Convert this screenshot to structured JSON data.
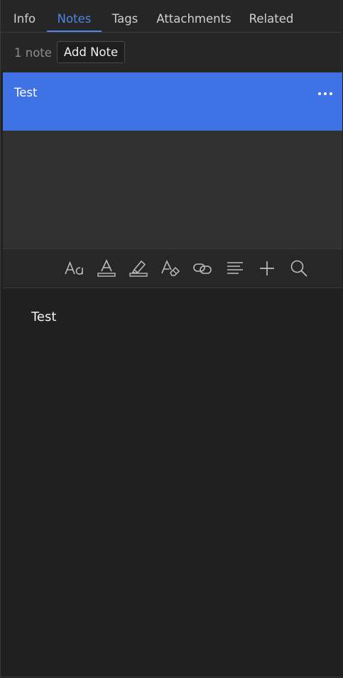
{
  "tabs": [
    {
      "label": "Info",
      "active": false
    },
    {
      "label": "Notes",
      "active": true
    },
    {
      "label": "Tags",
      "active": false
    },
    {
      "label": "Attachments",
      "active": false
    },
    {
      "label": "Related",
      "active": false
    }
  ],
  "notes_bar": {
    "count_label": "1 note",
    "add_label": "Add Note"
  },
  "notes": [
    {
      "title": "Test",
      "selected": true
    }
  ],
  "editor": {
    "toolbar_icons": [
      "font-size-icon",
      "text-color-icon",
      "highlight-icon",
      "clear-formatting-icon",
      "link-icon",
      "align-icon",
      "insert-icon",
      "find-icon"
    ],
    "content": "Test"
  },
  "colors": {
    "accent": "#4c86e8",
    "selected_row": "#3f72e4",
    "background": "#202020",
    "list_background": "#303030"
  }
}
